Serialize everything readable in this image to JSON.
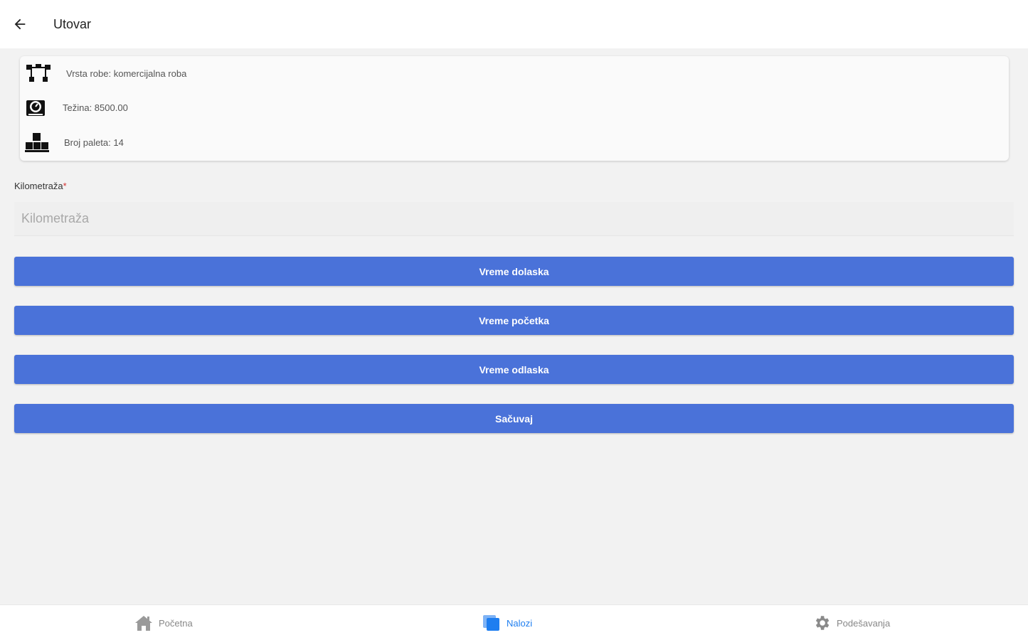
{
  "header": {
    "title": "Utovar",
    "back_icon": "arrow-left-icon"
  },
  "info_card": {
    "items": [
      {
        "icon": "cargo-type-icon",
        "text": "Vrsta robe: komercijalna roba"
      },
      {
        "icon": "scale-weight-icon",
        "text": "Težina: 8500.00"
      },
      {
        "icon": "pallets-icon",
        "text": "Broj paleta: 14"
      }
    ]
  },
  "km_field": {
    "label": "Kilometraža",
    "required_mark": "*",
    "placeholder": "Kilometraža",
    "value": ""
  },
  "buttons": {
    "arrival": "Vreme dolaska",
    "start": "Vreme početka",
    "departure": "Vreme odlaska",
    "save": "Sačuvaj"
  },
  "bottom_nav": {
    "items": [
      {
        "label": "Početna",
        "icon": "home-icon",
        "active": false
      },
      {
        "label": "Nalozi",
        "icon": "orders-icon",
        "active": true
      },
      {
        "label": "Podešavanja",
        "icon": "gear-icon",
        "active": false
      }
    ]
  },
  "colors": {
    "primary": "#4a72d9",
    "active_nav": "#1e7ef0",
    "required": "#d32f2f"
  }
}
